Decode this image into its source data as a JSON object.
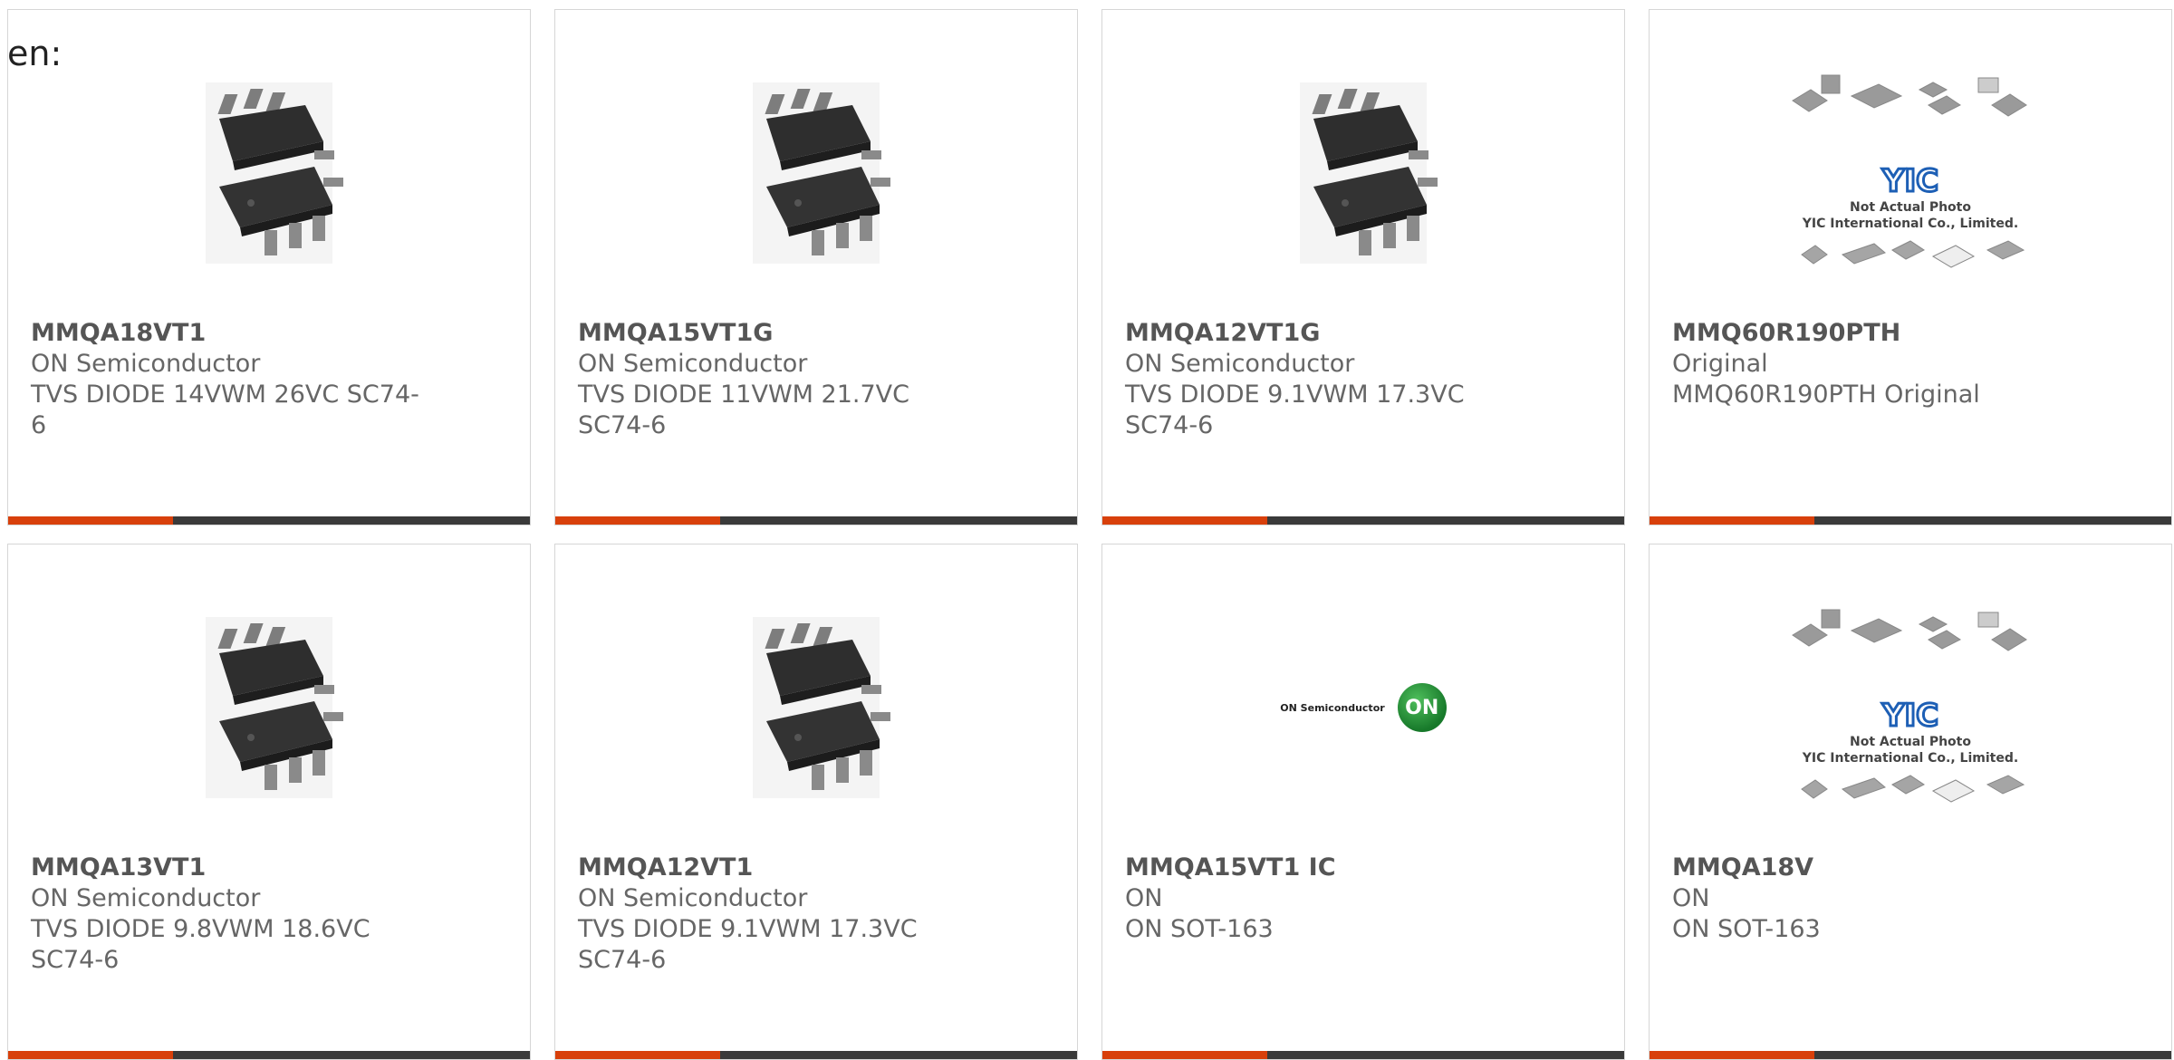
{
  "lang_label": "en:",
  "colors": {
    "accent": "#d8400b",
    "bar": "#3a3a3a",
    "card_border": "#d6d6d6",
    "text": "#666666"
  },
  "products": [
    {
      "part": "MMQA18VT1",
      "maker": "ON Semiconductor",
      "desc": "TVS DIODE 14VWM 26VC SC74-6",
      "image": "chip-sc74-photo"
    },
    {
      "part": "MMQA15VT1G",
      "maker": "ON Semiconductor",
      "desc": "TVS DIODE 11VWM 21.7VC SC74-6",
      "image": "chip-sc74-photo"
    },
    {
      "part": "MMQA12VT1G",
      "maker": "ON Semiconductor",
      "desc": "TVS DIODE 9.1VWM 17.3VC SC74-6",
      "image": "chip-sc74-photo"
    },
    {
      "part": "MMQ60R190PTH",
      "maker": "Original",
      "desc": "MMQ60R190PTH Original",
      "image": "yic-placeholder",
      "placeholder_line1": "Not Actual Photo",
      "placeholder_line2": "YIC International Co., Limited."
    },
    {
      "part": "MMQA13VT1",
      "maker": "ON Semiconductor",
      "desc": "TVS DIODE 9.8VWM 18.6VC SC74-6",
      "image": "chip-sc74-photo"
    },
    {
      "part": "MMQA12VT1",
      "maker": "ON Semiconductor",
      "desc": "TVS DIODE 9.1VWM 17.3VC SC74-6",
      "image": "chip-sc74-photo"
    },
    {
      "part": "MMQA15VT1 IC",
      "maker": "ON",
      "desc": "ON SOT-163",
      "image": "on-semiconductor-logo",
      "logo_text": "ON Semiconductor",
      "logo_mark": "ON"
    },
    {
      "part": "MMQA18V",
      "maker": "ON",
      "desc": "ON SOT-163",
      "image": "yic-placeholder",
      "placeholder_line1": "Not Actual Photo",
      "placeholder_line2": "YIC International Co., Limited."
    }
  ]
}
